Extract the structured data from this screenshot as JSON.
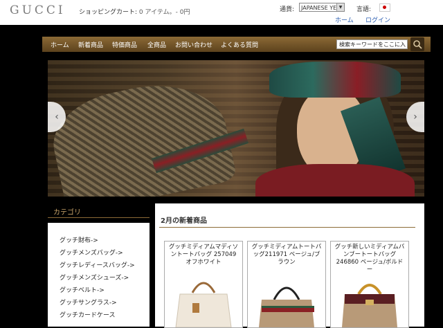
{
  "header": {
    "logo": "GUCCI",
    "cart_label": "ショッピングカート:",
    "cart_count": "0 アイテム。- 0円",
    "currency_label": "通貨:",
    "currency_value": "JAPANESE YE",
    "language_label": "言語:",
    "home_link": "ホーム",
    "login_link": "ログイン"
  },
  "nav": {
    "items": [
      "ホーム",
      "新着商品",
      "特価商品",
      "全商品",
      "お問い合わせ",
      "よくある質問"
    ],
    "search_placeholder": "検索キーワードをここに入"
  },
  "banner": {
    "prev": "‹",
    "next": "›"
  },
  "sidebar": {
    "title": "カテゴリ",
    "items": [
      "グッチ財布->",
      "グッチメンズバッグ->",
      "グッチレディースバッグ->",
      "グッチメンズシューズ->",
      "グッチベルト->",
      "グッチサングラス->",
      "グッチカードケース"
    ]
  },
  "main": {
    "title": "2月の新着商品",
    "products": [
      {
        "name": "グッチミディアムマディソントートバッグ 257049 オフホワイト"
      },
      {
        "name": "グッチミディアムトートバッグ211971 ベージュ/ブラウン"
      },
      {
        "name": "グッチ新しいミディアムバンブートートバッグ 246860 ベージュ/ボルドー"
      }
    ]
  },
  "colors": {
    "nav_gold": "#8c6a36",
    "background": "#000000"
  }
}
